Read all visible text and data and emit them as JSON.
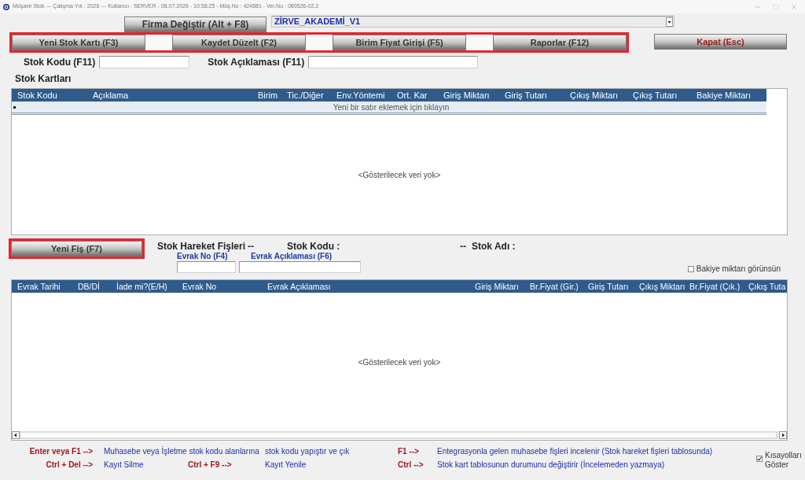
{
  "window": {
    "title": "Müşavir Stok --- Çalışma Yılı : 2026 --- Kullanıcı : SERVER - 08.07.2026 - 10:58:25 - Müş.No : 424681 - Ver.No : 060526-02.2"
  },
  "company": {
    "button": "Firma Değiştir (Alt + F8)",
    "selected_company": "ZİRVE_AKADEMİ_V1"
  },
  "toolbar": {
    "highlighted": true,
    "buttons": [
      "Yeni Stok Kartı (F3)",
      "Kaydet Düzelt (F2)",
      "Birim Fiyat Girişi (F5)",
      "Raporlar (F12)"
    ]
  },
  "close_button": "Kapat (Esc)",
  "filters": [
    {
      "label": "Stok Kodu (F11)"
    },
    {
      "label": "Stok Açıklaması (F11)"
    }
  ],
  "stock_cards": {
    "title": "Stok Kartları",
    "columns": [
      "Stok Kodu",
      "Açıklama",
      "Birim",
      "Tic./Diğer",
      "Env.Yöntemi",
      "Ort. Kar",
      "Giriş Miktarı",
      "Giriş Tutarı",
      "Çıkış Miktarı",
      "Çıkış Tutarı",
      "Bakiye Miktarı"
    ],
    "new_row_hint": "Yeni bir satır eklemek için tıklayın",
    "empty_message": "<Gösterilecek veri yok>"
  },
  "movements": {
    "new_button": {
      "label": "Yeni Fiş (F7)",
      "highlighted": true
    },
    "header": [
      "Stok Hareket Fişleri",
      "--",
      "Stok Kodu :",
      "--",
      "Stok Adı :"
    ],
    "filters": [
      {
        "label": "Evrak No (F4)"
      },
      {
        "label": "Evrak Açıklaması (F6)"
      }
    ],
    "balance_checkbox": {
      "label": "Bakiye miktarı görünsün",
      "checked": false
    },
    "columns": [
      "Evrak Tarihi",
      "DB/Dİ",
      "İade mi?(E/H)",
      "Evrak No",
      "Evrak Açıklaması",
      "Giriş Miktarı",
      "Br.Fiyat (Gir.)",
      "Giriş Tutarı",
      "Çıkış Miktarı",
      "Br.Fiyat (Çık.)",
      "Çıkış Tuta"
    ],
    "empty_message": "<Gösterilecek veri yok>"
  },
  "shortcuts": {
    "rows": [
      [
        {
          "kind": "key",
          "text": "Enter veya F1 -->"
        },
        {
          "kind": "text",
          "text": "Muhasebe veya İşletme stok kodu alanlarına"
        },
        {
          "kind": "key",
          "text": ""
        },
        {
          "kind": "text",
          "text": "stok kodu yapıştır ve çık"
        },
        {
          "kind": "key",
          "text": "F1 -->"
        },
        {
          "kind": "text",
          "text": "Entegrasyonla gelen muhasebe fişleri incelenir (Stok hareket fişleri tablosunda)"
        }
      ],
      [
        {
          "kind": "key",
          "text": "Ctrl + Del -->"
        },
        {
          "kind": "text",
          "text": "Kayıt Silme"
        },
        {
          "kind": "key",
          "text": "Ctrl + F9 -->"
        },
        {
          "kind": "text",
          "text": "Kayıt Yenile"
        },
        {
          "kind": "key",
          "text": "Ctrl -->"
        },
        {
          "kind": "text",
          "text": "Stok kart tablosunun durumunu değiştirir (İncelemeden yazmaya)"
        }
      ]
    ],
    "show_checkbox": {
      "label": "Kısayolları Göster",
      "checked": true
    }
  }
}
